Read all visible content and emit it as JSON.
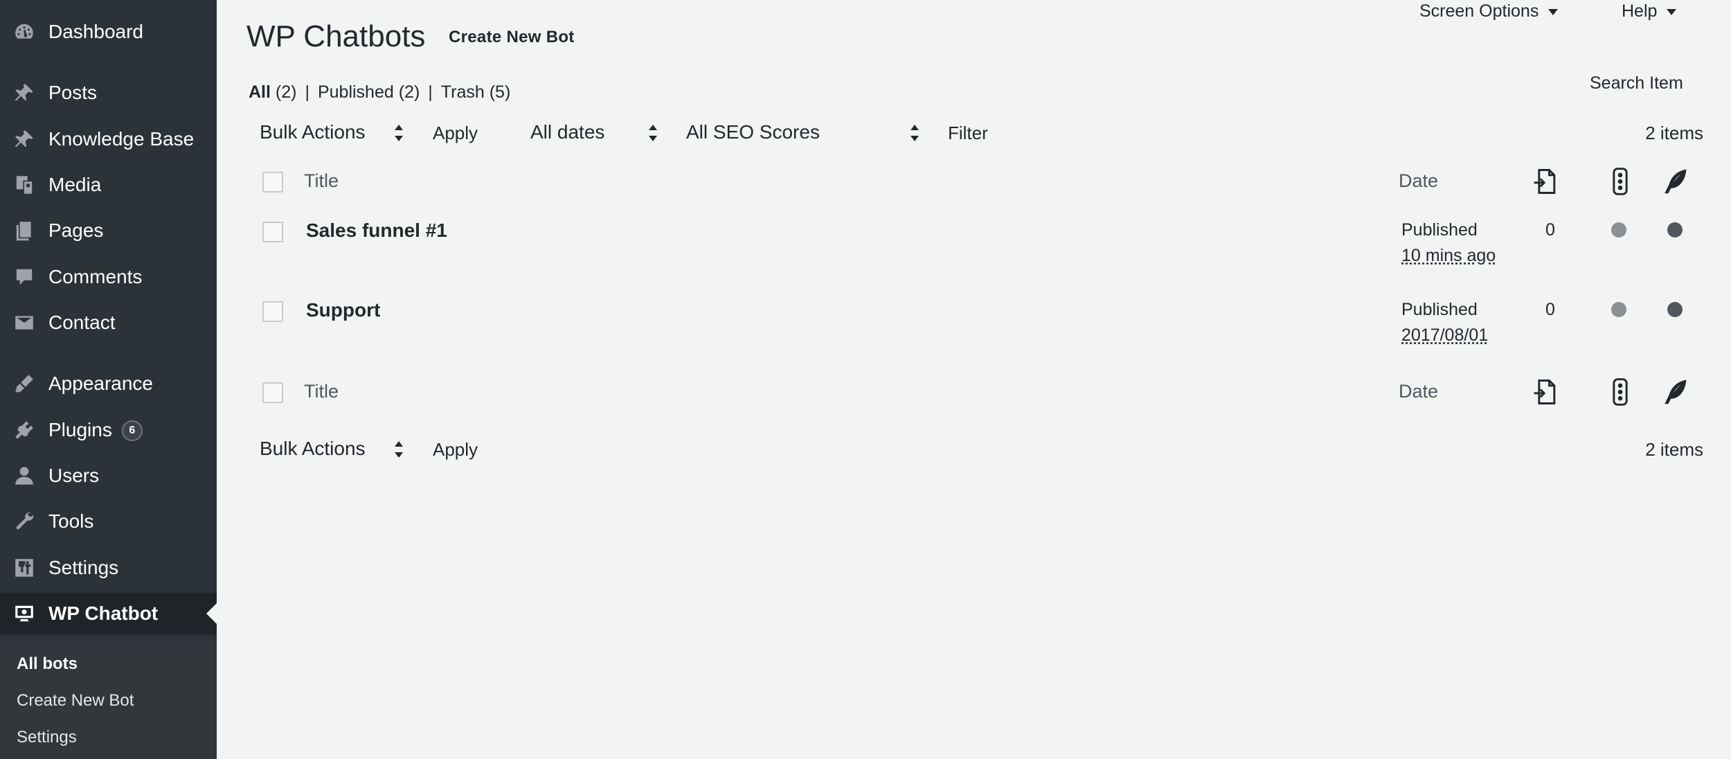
{
  "sidebar": {
    "items": [
      {
        "label": "Dashboard",
        "icon": "dashboard-icon"
      },
      {
        "label": "Posts",
        "icon": "pin-icon"
      },
      {
        "label": "Knowledge Base",
        "icon": "pin-icon"
      },
      {
        "label": "Media",
        "icon": "media-icon"
      },
      {
        "label": "Pages",
        "icon": "pages-icon"
      },
      {
        "label": "Comments",
        "icon": "comment-icon"
      },
      {
        "label": "Contact",
        "icon": "mail-icon"
      },
      {
        "label": "Appearance",
        "icon": "brush-icon"
      },
      {
        "label": "Plugins",
        "icon": "plugin-icon",
        "badge": "6"
      },
      {
        "label": "Users",
        "icon": "user-icon"
      },
      {
        "label": "Tools",
        "icon": "wrench-icon"
      },
      {
        "label": "Settings",
        "icon": "settings-icon"
      },
      {
        "label": "WP Chatbot",
        "icon": "chatbot-icon",
        "current": true
      }
    ],
    "submenu": [
      {
        "label": "All bots",
        "active": true
      },
      {
        "label": "Create New Bot"
      },
      {
        "label": "Settings"
      }
    ]
  },
  "header": {
    "title": "WP Chatbots",
    "action": "Create New Bot",
    "screen_options": "Screen Options",
    "help": "Help"
  },
  "views": {
    "all": "All",
    "all_count": "(2)",
    "published": "Published",
    "published_count": "(2)",
    "trash": "Trash",
    "trash_count": "(5)",
    "separator": "|"
  },
  "search": {
    "button": "Search Item"
  },
  "filters": {
    "bulk_actions": "Bulk Actions",
    "apply": "Apply",
    "dates": "All dates",
    "seo": "All SEO Scores",
    "filter": "Filter",
    "count": "2 items"
  },
  "table": {
    "columns": {
      "title": "Title",
      "date": "Date"
    },
    "column_icons": [
      "links-icon",
      "traffic-light-icon",
      "feather-icon"
    ],
    "rows": [
      {
        "title": "Sales funnel #1",
        "status": "Published",
        "date": "10 mins ago",
        "links": "0",
        "dot1_color": "#8c8f94",
        "dot2_color": "#50575e"
      },
      {
        "title": "Support",
        "status": "Published",
        "date": "2017/08/01",
        "links": "0",
        "dot1_color": "#8c8f94",
        "dot2_color": "#50575e"
      }
    ]
  },
  "bottom": {
    "bulk_actions": "Bulk Actions",
    "apply": "Apply",
    "count": "2 items"
  },
  "colors": {
    "sidebar_bg": "#2c3338",
    "submenu_bg": "#32373c",
    "page_bg": "#f2f4f4",
    "text": "#23282d"
  }
}
